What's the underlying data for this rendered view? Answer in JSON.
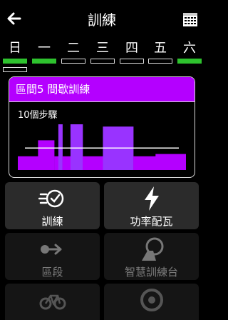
{
  "header": {
    "title": "訓練",
    "back_icon": "back-arrow-icon",
    "calendar_icon": "calendar-icon"
  },
  "week": [
    {
      "label": "日",
      "status": "done"
    },
    {
      "label": "一",
      "status": "done"
    },
    {
      "label": "二",
      "status": "empty"
    },
    {
      "label": "三",
      "status": "empty"
    },
    {
      "label": "四",
      "status": "empty"
    },
    {
      "label": "五",
      "status": "empty"
    },
    {
      "label": "六",
      "status": "done"
    }
  ],
  "workout": {
    "title": "區間5 間歇訓練",
    "steps": "10個步驟",
    "accent": "#b400ff",
    "chart_data": {
      "type": "bar",
      "steps": [
        0.3,
        0.65,
        0.3,
        1.0,
        0.3,
        1.0,
        0.3,
        0.95,
        0.3,
        0.35
      ],
      "target_line": 0.48
    }
  },
  "menu": [
    {
      "label": "訓練",
      "icon": "training-clock-icon",
      "enabled": true
    },
    {
      "label": "功率配瓦",
      "icon": "lightning-icon",
      "enabled": true
    },
    {
      "label": "區段",
      "icon": "segment-arrow-icon",
      "enabled": false
    },
    {
      "label": "智慧訓練台",
      "icon": "smart-trainer-icon",
      "enabled": false
    },
    {
      "label": "",
      "icon": "bike-icon",
      "enabled": false
    },
    {
      "label": "",
      "icon": "target-icon",
      "enabled": false
    }
  ]
}
